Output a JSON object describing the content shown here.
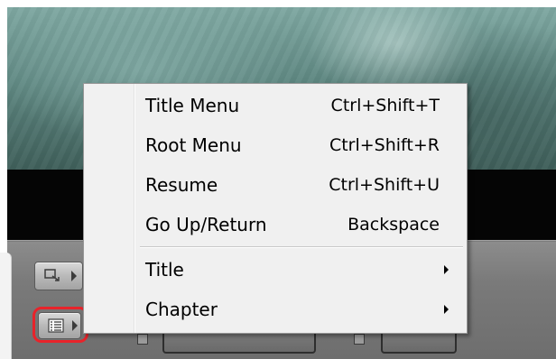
{
  "context_menu": {
    "items": [
      {
        "label": "Title Menu",
        "shortcut": "Ctrl+Shift+T"
      },
      {
        "label": "Root Menu",
        "shortcut": "Ctrl+Shift+R"
      },
      {
        "label": "Resume",
        "shortcut": "Ctrl+Shift+U"
      },
      {
        "label": "Go Up/Return",
        "shortcut": "Backspace"
      },
      {
        "label": "Title",
        "submenu": true
      },
      {
        "label": "Chapter",
        "submenu": true
      }
    ]
  },
  "controls": {
    "aspect_button_icon": "aspect-ratio-icon",
    "menu_button_icon": "menu-list-icon",
    "highlight_color": "#e8232a"
  }
}
